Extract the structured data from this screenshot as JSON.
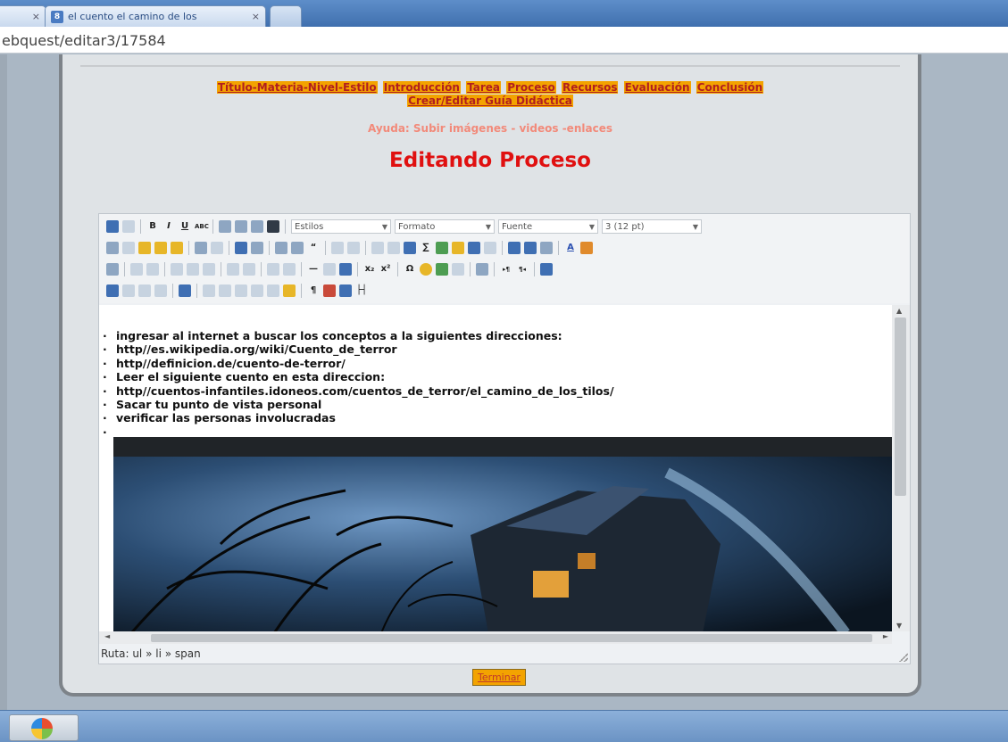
{
  "browser": {
    "tabs": [
      {
        "label": "",
        "close": "×"
      },
      {
        "label": "el cuento el camino de los",
        "close": "×",
        "favicon": "8"
      },
      {
        "label": ""
      }
    ],
    "address": "ebquest/editar3/17584"
  },
  "page": {
    "nav_links": [
      "Título-Materia-Nivel-Estilo",
      "Introducción",
      "Tarea",
      "Proceso",
      "Recursos",
      "Evaluación",
      "Conclusión",
      "Crear/Editar Guía Didáctica"
    ],
    "help_text": "Ayuda: Subir imágenes - videos -enlaces",
    "title": "Editando Proceso",
    "finish_button": "Terminar"
  },
  "editor": {
    "dropdowns": {
      "styles": "Estilos",
      "format": "Formato",
      "font": "Fuente",
      "size": "3 (12 pt)"
    },
    "content_items": [
      "ingresar al internet a buscar los conceptos a la siguientes direcciones:",
      "http//es.wikipedia.org/wiki/Cuento_de_terror",
      "http//definicion.de/cuento-de-terror/",
      "Leer el siguiente cuento en esta direccion:",
      "http//cuentos-infantiles.idoneos.com/cuentos_de_terror/el_camino_de_los_tilos/",
      "Sacar tu punto de vista personal",
      "verificar las personas involucradas",
      ""
    ],
    "path_status": "Ruta: ul » li » span"
  },
  "colors": {
    "link_bg": "#f3a300",
    "link_text": "#b11f1f",
    "title": "#e01010",
    "help": "#f28a7a"
  }
}
